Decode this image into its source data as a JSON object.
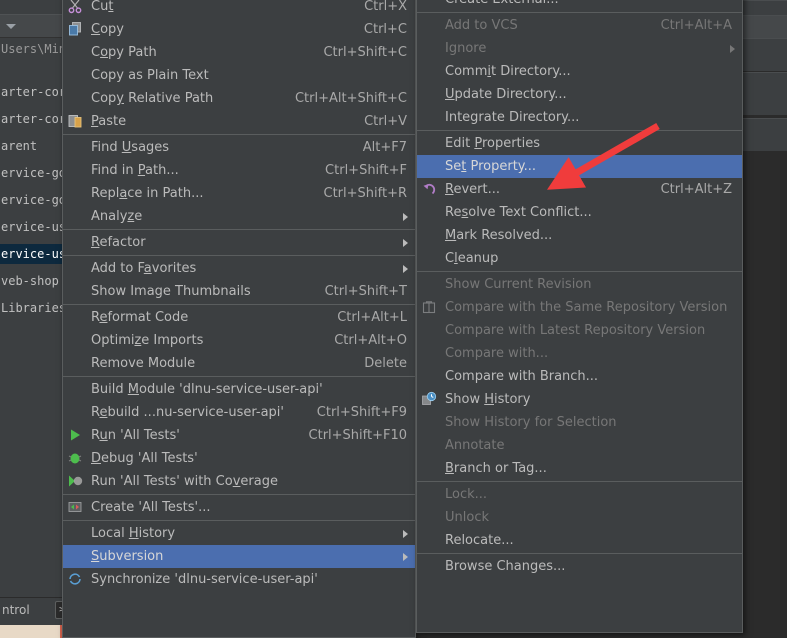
{
  "window": {
    "app": "IntelliJ IDEA",
    "theme_bg": "#3c3f41",
    "editor_bg": "#2b2b2b",
    "highlight_color": "#4b6eaf",
    "selection_color": "#0d293e",
    "annotation_arrow_color": "#f03c3c"
  },
  "project_tree": {
    "path_label": "Users\\Ming",
    "items": [
      {
        "label": "arter-cor",
        "selected": false
      },
      {
        "label": "arter-cor",
        "selected": false
      },
      {
        "label": "arent",
        "selected": false
      },
      {
        "label": "ervice-go",
        "selected": false
      },
      {
        "label": "ervice-go",
        "selected": false
      },
      {
        "label": "ervice-us",
        "selected": false
      },
      {
        "label": "ervice-us",
        "selected": true
      },
      {
        "label": "veb-shop",
        "selected": false
      },
      {
        "label": "Libraries",
        "selected": false
      }
    ]
  },
  "bottom_bar": {
    "vcs_tab_label": "ntrol",
    "terminal_icon": "terminal-icon",
    "terminal_glyph": ">_"
  },
  "context_menu": {
    "name": "module-context-menu",
    "items": [
      {
        "type": "item",
        "icon": "cut-icon",
        "label": "Cut",
        "accel": "Ctrl+X",
        "mnemonic": "t"
      },
      {
        "type": "item",
        "icon": "copy-icon",
        "label": "Copy",
        "accel": "Ctrl+C",
        "mnemonic": "C"
      },
      {
        "type": "item",
        "icon": null,
        "label": "Copy Path",
        "accel": "Ctrl+Shift+C",
        "mnemonic": "o"
      },
      {
        "type": "item",
        "icon": null,
        "label": "Copy as Plain Text",
        "accel": ""
      },
      {
        "type": "item",
        "icon": null,
        "label": "Copy Relative Path",
        "accel": "Ctrl+Alt+Shift+C",
        "mnemonic": "y"
      },
      {
        "type": "item",
        "icon": "paste-icon",
        "label": "Paste",
        "accel": "Ctrl+V",
        "mnemonic": "P"
      },
      {
        "type": "separator"
      },
      {
        "type": "item",
        "icon": null,
        "label": "Find Usages",
        "accel": "Alt+F7",
        "mnemonic": "U"
      },
      {
        "type": "item",
        "icon": null,
        "label": "Find in Path...",
        "accel": "Ctrl+Shift+F",
        "mnemonic": "P"
      },
      {
        "type": "item",
        "icon": null,
        "label": "Replace in Path...",
        "accel": "Ctrl+Shift+R",
        "mnemonic": "a"
      },
      {
        "type": "item",
        "icon": null,
        "label": "Analyze",
        "accel": "",
        "submenu": true,
        "mnemonic": "z"
      },
      {
        "type": "separator"
      },
      {
        "type": "item",
        "icon": null,
        "label": "Refactor",
        "accel": "",
        "submenu": true,
        "mnemonic": "R"
      },
      {
        "type": "separator"
      },
      {
        "type": "item",
        "icon": null,
        "label": "Add to Favorites",
        "accel": "",
        "submenu": true,
        "mnemonic": "a"
      },
      {
        "type": "item",
        "icon": null,
        "label": "Show Image Thumbnails",
        "accel": "Ctrl+Shift+T"
      },
      {
        "type": "separator"
      },
      {
        "type": "item",
        "icon": null,
        "label": "Reformat Code",
        "accel": "Ctrl+Alt+L",
        "mnemonic": "e"
      },
      {
        "type": "item",
        "icon": null,
        "label": "Optimize Imports",
        "accel": "Ctrl+Alt+O",
        "mnemonic": "z"
      },
      {
        "type": "item",
        "icon": null,
        "label": "Remove Module",
        "accel": "Delete"
      },
      {
        "type": "separator"
      },
      {
        "type": "item",
        "icon": null,
        "label": "Build Module 'dlnu-service-user-api'",
        "accel": "",
        "mnemonic": "M"
      },
      {
        "type": "item",
        "icon": null,
        "label": "Rebuild ...nu-service-user-api'",
        "accel": "Ctrl+Shift+F9",
        "mnemonic": "e"
      },
      {
        "type": "item",
        "icon": "run-icon",
        "label": "Run 'All Tests'",
        "accel": "Ctrl+Shift+F10",
        "mnemonic": "u"
      },
      {
        "type": "item",
        "icon": "debug-icon",
        "label": "Debug 'All Tests'",
        "accel": "",
        "mnemonic": "D"
      },
      {
        "type": "item",
        "icon": "coverage-icon",
        "label": "Run 'All Tests' with Coverage",
        "accel": "",
        "mnemonic": "v"
      },
      {
        "type": "separator"
      },
      {
        "type": "item",
        "icon": "create-test-icon",
        "label": "Create 'All Tests'...",
        "accel": ""
      },
      {
        "type": "separator"
      },
      {
        "type": "item",
        "icon": null,
        "label": "Local History",
        "accel": "",
        "submenu": true,
        "mnemonic": "H"
      },
      {
        "type": "item",
        "icon": null,
        "label": "Subversion",
        "accel": "",
        "submenu": true,
        "highlight": true,
        "mnemonic": "S"
      },
      {
        "type": "item",
        "icon": "synchronize-icon",
        "label": "Synchronize 'dlnu-service-user-api'",
        "accel": "",
        "clipped": true
      }
    ]
  },
  "submenu": {
    "name": "subversion-submenu",
    "items": [
      {
        "type": "item",
        "icon": null,
        "label": "Create External...",
        "accel": "",
        "clipped_top": true
      },
      {
        "type": "separator"
      },
      {
        "type": "item",
        "icon": null,
        "label": "Add to VCS",
        "accel": "Ctrl+Alt+A",
        "disabled": true
      },
      {
        "type": "item",
        "icon": null,
        "label": "Ignore",
        "accel": "",
        "submenu": true,
        "disabled": true
      },
      {
        "type": "item",
        "icon": null,
        "label": "Commit Directory...",
        "accel": "",
        "mnemonic": "i"
      },
      {
        "type": "item",
        "icon": null,
        "label": "Update Directory...",
        "accel": "",
        "mnemonic": "U"
      },
      {
        "type": "item",
        "icon": null,
        "label": "Integrate Directory...",
        "accel": ""
      },
      {
        "type": "separator"
      },
      {
        "type": "item",
        "icon": null,
        "label": "Edit Properties",
        "accel": "",
        "mnemonic": "P"
      },
      {
        "type": "item",
        "icon": null,
        "label": "Set Property...",
        "accel": "",
        "highlight": true,
        "mnemonic": "t"
      },
      {
        "type": "item",
        "icon": "revert-icon",
        "label": "Revert...",
        "accel": "Ctrl+Alt+Z",
        "mnemonic": "R"
      },
      {
        "type": "item",
        "icon": null,
        "label": "Resolve Text Conflict...",
        "accel": "",
        "mnemonic": "s"
      },
      {
        "type": "item",
        "icon": null,
        "label": "Mark Resolved...",
        "accel": "",
        "mnemonic": "M"
      },
      {
        "type": "item",
        "icon": null,
        "label": "Cleanup",
        "accel": "",
        "mnemonic": "l"
      },
      {
        "type": "separator"
      },
      {
        "type": "item",
        "icon": null,
        "label": "Show Current Revision",
        "accel": "",
        "disabled": true
      },
      {
        "type": "item",
        "icon": "compare-icon",
        "label": "Compare with the Same Repository Version",
        "accel": "",
        "disabled": true
      },
      {
        "type": "item",
        "icon": null,
        "label": "Compare with Latest Repository Version",
        "accel": "",
        "disabled": true
      },
      {
        "type": "item",
        "icon": null,
        "label": "Compare with...",
        "accel": "",
        "disabled": true
      },
      {
        "type": "item",
        "icon": null,
        "label": "Compare with Branch...",
        "accel": ""
      },
      {
        "type": "item",
        "icon": "history-icon",
        "label": "Show History",
        "accel": "",
        "mnemonic": "H"
      },
      {
        "type": "item",
        "icon": null,
        "label": "Show History for Selection",
        "accel": "",
        "disabled": true
      },
      {
        "type": "item",
        "icon": null,
        "label": "Annotate",
        "accel": "",
        "disabled": true
      },
      {
        "type": "item",
        "icon": null,
        "label": "Branch or Tag...",
        "accel": "",
        "mnemonic": "B"
      },
      {
        "type": "separator"
      },
      {
        "type": "item",
        "icon": null,
        "label": "Lock...",
        "accel": "",
        "disabled": true
      },
      {
        "type": "item",
        "icon": null,
        "label": "Unlock",
        "accel": "",
        "disabled": true
      },
      {
        "type": "item",
        "icon": null,
        "label": "Relocate...",
        "accel": ""
      },
      {
        "type": "separator"
      },
      {
        "type": "item",
        "icon": null,
        "label": "Browse Changes...",
        "accel": ""
      }
    ]
  }
}
